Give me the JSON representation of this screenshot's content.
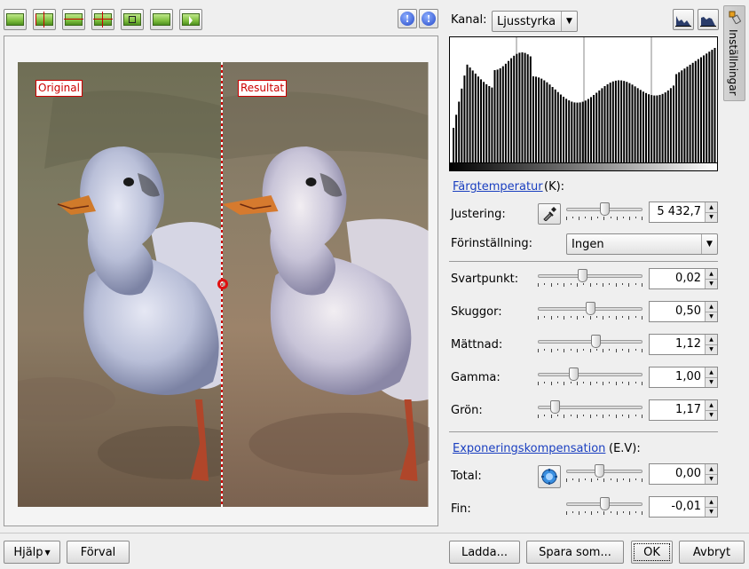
{
  "toolbar": {
    "buttons": [
      "original-image-icon",
      "split-vertical-icon",
      "split-horizontal-icon",
      "compare-vertical-icon",
      "compare-horizontal-icon",
      "target-image-icon",
      "cursor-select-icon"
    ],
    "info_label": "!"
  },
  "preview": {
    "original_label": "Original",
    "result_label": "Resultat"
  },
  "histogram": {
    "channel_label": "Kanal:",
    "channel_value": "Ljusstyrka",
    "linear_icon": "linear-histogram-icon",
    "log_icon": "log-histogram-icon"
  },
  "side_tab": {
    "label": "Inställningar"
  },
  "temperature": {
    "link_label": "Färgtemperatur",
    "suffix": "(K):",
    "adjust_label": "Justering:",
    "adjust_value": "5 432,7",
    "adjust_fraction": 0.5,
    "preset_label": "Förinställning:",
    "preset_value": "Ingen"
  },
  "controls": [
    {
      "label": "Svartpunkt:",
      "value": "0,02",
      "fraction": 0.42
    },
    {
      "label": "Skuggor:",
      "value": "0,50",
      "fraction": 0.5
    },
    {
      "label": "Mättnad:",
      "value": "1,12",
      "fraction": 0.56
    },
    {
      "label": "Gamma:",
      "value": "1,00",
      "fraction": 0.33
    },
    {
      "label": "Grön:",
      "value": "1,17",
      "fraction": 0.13
    }
  ],
  "exposure": {
    "link_label": "Exponeringskompensation",
    "suffix": "(E.V):",
    "total_label": "Total:",
    "total_value": "0,00",
    "total_fraction": 0.42,
    "fine_label": "Fin:",
    "fine_value": "-0,01",
    "fine_fraction": 0.5
  },
  "footer": {
    "help": "Hjälp",
    "defaults": "Förval",
    "load": "Ladda...",
    "save_as": "Spara som...",
    "ok": "OK",
    "cancel": "Avbryt"
  },
  "colors": {
    "link": "#1a3fc0",
    "label_red": "#cc0000"
  }
}
